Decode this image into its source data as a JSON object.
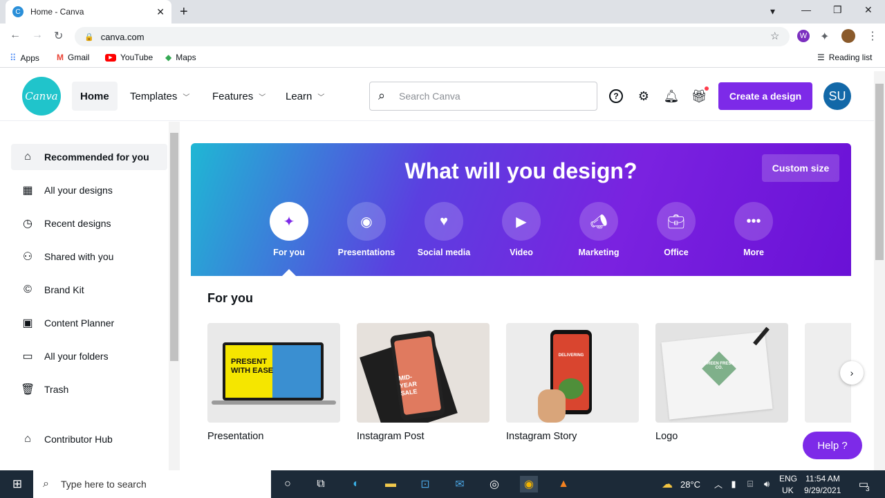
{
  "browser": {
    "tab_title": "Home - Canva",
    "url": "canva.com",
    "bookmarks": [
      "Apps",
      "Gmail",
      "YouTube",
      "Maps"
    ],
    "reading_list": "Reading list"
  },
  "header": {
    "logo": "Canva",
    "nav": [
      "Home",
      "Templates",
      "Features",
      "Learn"
    ],
    "search_placeholder": "Search Canva",
    "create_button": "Create a design",
    "avatar_initials": "SU"
  },
  "sidebar": {
    "items": [
      "Recommended for you",
      "All your designs",
      "Recent designs",
      "Shared with you",
      "Brand Kit",
      "Content Planner",
      "All your folders",
      "Trash",
      "Contributor Hub"
    ]
  },
  "banner": {
    "title": "What will you design?",
    "custom_size": "Custom size",
    "categories": [
      "For you",
      "Presentations",
      "Social media",
      "Video",
      "Marketing",
      "Office",
      "More"
    ]
  },
  "for_you": {
    "heading": "For you",
    "cards": [
      "Presentation",
      "Instagram Post",
      "Instagram Story",
      "Logo"
    ],
    "thumb_text": {
      "presentation": "PRESENT WITH EASE",
      "post": "MID-YEAR SALE",
      "story": "DELIVERING",
      "logo": "GREEN FRESH CO."
    }
  },
  "help_button": "Help ?",
  "taskbar": {
    "search_placeholder": "Type here to search",
    "weather": "28°C",
    "language": "ENG",
    "region": "UK",
    "time": "11:54 AM",
    "date": "9/29/2021",
    "notifications": "3"
  },
  "colors": {
    "accent": "#7d2ae8",
    "canva_teal": "#20c4cb"
  }
}
